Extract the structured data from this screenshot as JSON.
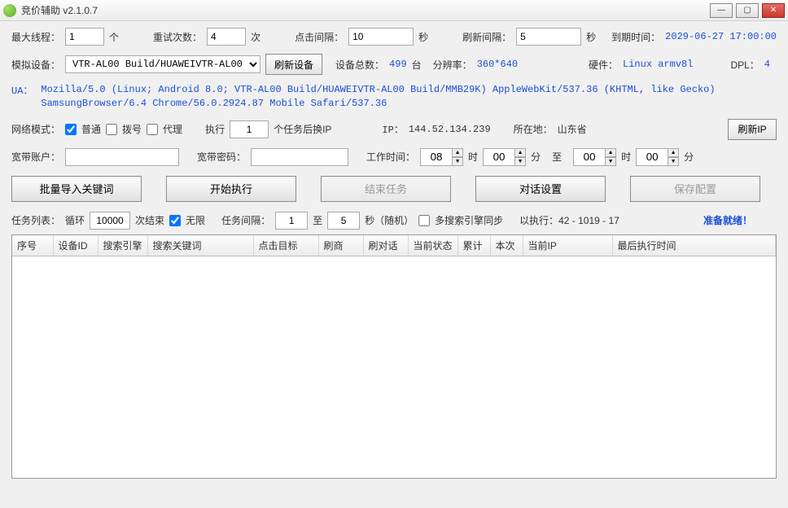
{
  "title": "竞价辅助 v2.1.0.7",
  "row1": {
    "maxThreadsLabel": "最大线程：",
    "maxThreads": "1",
    "unitGe": "个",
    "retryLabel": "重试次数：",
    "retry": "4",
    "unitCi": "次",
    "clickIntervalLabel": "点击间隔：",
    "clickInterval": "10",
    "unitSec": "秒",
    "refreshIntervalLabel": "刷新间隔：",
    "refreshInterval": "5",
    "unitSec2": "秒",
    "expireLabel": "到期时间：",
    "expireValue": "2029-06-27 17:00:00"
  },
  "row2": {
    "deviceLabel": "模拟设备：",
    "deviceValue": "VTR-AL00 Build/HUAWEIVTR-AL00",
    "refreshDeviceBtn": "刷新设备",
    "totalLabel": "设备总数：",
    "totalValue": "499",
    "tai": "台",
    "resLabel": "分辨率：",
    "resValue": "360*640",
    "hwLabel": "硬件：",
    "hwValue": "Linux armv8l",
    "dplLabel": "DPL：",
    "dplValue": "4"
  },
  "ua": {
    "label": "UA：",
    "value": "Mozilla/5.0 (Linux; Android 8.0; VTR-AL00 Build/HUAWEIVTR-AL00 Build/MMB29K) AppleWebKit/537.36 (KHTML, like Gecko) SamsungBrowser/6.4 Chrome/56.0.2924.87 Mobile Safari/537.36"
  },
  "row4": {
    "netModeLabel": "网络模式：",
    "normal": "普通",
    "dial": "拨号",
    "proxy": "代理",
    "execLabel": "执行",
    "execValue": "1",
    "execSuffix": "个任务后换IP",
    "ipLabel": "IP：",
    "ipValue": "144.52.134.239",
    "locLabel": "所在地：",
    "locValue": "山东省",
    "refreshIpBtn": "刷新IP"
  },
  "row5": {
    "bbAccountLabel": "宽带账户：",
    "bbPwdLabel": "宽带密码：",
    "workTimeLabel": "工作时间：",
    "h1": "08",
    "hLabel": "时",
    "m1": "00",
    "mLabel": "分",
    "to": "至",
    "h2": "00",
    "m2": "00"
  },
  "buttons": {
    "importKw": "批量导入关键词",
    "start": "开始执行",
    "end": "结束任务",
    "dialog": "对话设置",
    "save": "保存配置"
  },
  "taskRow": {
    "listLabel": "任务列表：",
    "loopLabel": "循环",
    "loopValue": "10000",
    "loopSuffix": "次结束",
    "unlimited": "无限",
    "taskIntervalLabel": "任务间隔：",
    "intMin": "1",
    "intTo": "至",
    "intMax": "5",
    "intSuffix": "秒（随机）",
    "multiEngine": "多搜索引擎同步",
    "execStats": "以执行：42 - 1019 - 17",
    "readyStatus": "准备就绪！"
  },
  "cols": {
    "c1": "序号",
    "c2": "设备ID",
    "c3": "搜索引擎",
    "c4": "搜索关键词",
    "c5": "点击目标",
    "c6": "刷商",
    "c7": "刷对话",
    "c8": "当前状态",
    "c9": "累计",
    "c10": "本次",
    "c11": "当前IP",
    "c12": "最后执行时间"
  }
}
